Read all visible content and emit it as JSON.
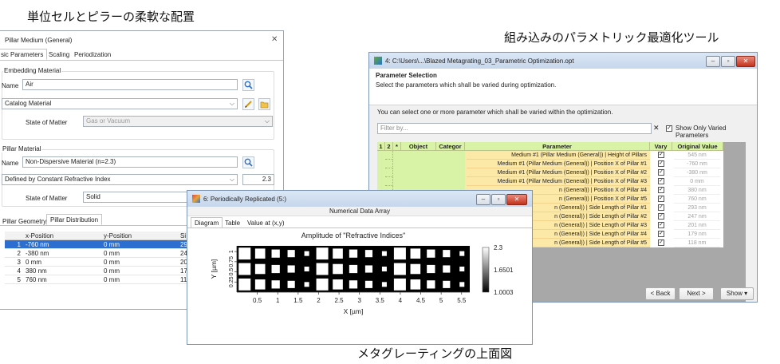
{
  "captions": {
    "top_left": "単位セルとピラーの柔軟な配置",
    "top_right": "組み込みのパラメトリック最適化ツール",
    "bottom": "メタグレーティングの上面図"
  },
  "pillar_dialog": {
    "title": "Pillar Medium (General)",
    "close": "✕",
    "tabs": [
      "sic Parameters",
      "Scaling",
      "Periodization"
    ],
    "embedding_group": "Embedding Material",
    "name_label": "Name",
    "name_value": "Air",
    "catalog_value": "Catalog Material",
    "state_label": "State of Matter",
    "state_value": "Gas or Vacuum",
    "pillar_group": "Pillar Material",
    "pillar_name_value": "Non-Dispersive Material (n=2.3)",
    "defined_by_value": "Defined by Constant Refractive Index",
    "refractive_index": "2.3",
    "pillar_state_value": "Solid",
    "lower_tabs": [
      "Pillar Geometry",
      "Pillar Distribution"
    ],
    "grid_headers": [
      "x-Position",
      "y-Position",
      "Si"
    ],
    "rows": [
      {
        "n": "1",
        "x": "-760 nm",
        "y": "0 mm",
        "s": "29"
      },
      {
        "n": "2",
        "x": "-380 nm",
        "y": "0 mm",
        "s": "24"
      },
      {
        "n": "3",
        "x": "0 mm",
        "y": "0 mm",
        "s": "20"
      },
      {
        "n": "4",
        "x": "380 nm",
        "y": "0 mm",
        "s": "17"
      },
      {
        "n": "5",
        "x": "760 nm",
        "y": "0 mm",
        "s": "11"
      }
    ]
  },
  "opt_window": {
    "title": "4: C:\\Users\\...\\Blazed Metagrating_03_Parametric Optimization.opt",
    "header_title": "Parameter Selection",
    "header_desc": "Select the parameters which shall be varied during optimization.",
    "instruction": "You can select one or more parameter which shall be varied within the optimization.",
    "filter_placeholder": "Filter by...",
    "filter_clear": "✕",
    "show_only_varied": "Show Only Varied Parameters",
    "headers": {
      "one": "1",
      "two": "2",
      "star": "*",
      "object": "Object",
      "category": "Categor",
      "parameter": "Parameter",
      "vary": "Vary",
      "original": "Original Value"
    },
    "params": [
      {
        "p": "Medium #1 (Pillar Medium (General)) | Height of Pillars",
        "v": "545 nm"
      },
      {
        "p": "Medium #1 (Pillar Medium (General)) | Position X of Pillar #1",
        "v": "-760 nm"
      },
      {
        "p": "Medium #1 (Pillar Medium (General)) | Position X of Pillar #2",
        "v": "-380 nm"
      },
      {
        "p": "Medium #1 (Pillar Medium (General)) | Position X of Pillar #3",
        "v": "0 mm"
      },
      {
        "p": "n (General)) | Position X of Pillar #4",
        "v": "380 nm"
      },
      {
        "p": "n (General)) | Position X of Pillar #5",
        "v": "760 nm"
      },
      {
        "p": "n (General)) | Side Length of Pillar #1",
        "v": "293 nm"
      },
      {
        "p": "n (General)) | Side Length of Pillar #2",
        "v": "247 nm"
      },
      {
        "p": "n (General)) | Side Length of Pillar #3",
        "v": "201 nm"
      },
      {
        "p": "n (General)) | Side Length of Pillar #4",
        "v": "179 nm"
      },
      {
        "p": "n (General)) | Side Length of Pillar #5",
        "v": "118 nm"
      }
    ],
    "back": "< Back",
    "next": "Next >",
    "show": "Show ▾"
  },
  "rep_window": {
    "title": "6: Periodically Replicated (5:)",
    "subtitle": "Numerical Data Array",
    "tabs": [
      "Diagram",
      "Table",
      "Value at (x,y)"
    ]
  },
  "chart_data": {
    "type": "heatmap",
    "title": "Amplitude of \"Refractive Indices\"",
    "xlabel": "X [µm]",
    "ylabel": "Y [µm]",
    "xlim": [
      0,
      5.7
    ],
    "ylim": [
      0,
      1.14
    ],
    "xticks": [
      "0.5",
      "1",
      "1.5",
      "2",
      "2.5",
      "3",
      "3.5",
      "4",
      "4.5",
      "5",
      "5.5"
    ],
    "xtick_values": [
      0.5,
      1,
      1.5,
      2,
      2.5,
      3,
      3.5,
      4,
      4.5,
      5,
      5.5
    ],
    "yticks": [
      "0.25",
      "0.5",
      "0.75",
      "1"
    ],
    "ytick_values": [
      0.25,
      0.5,
      0.75,
      1
    ],
    "colorbar_labels": [
      "2.3",
      "1.6501",
      "1.0003"
    ],
    "colorbar_range": [
      1.0003,
      2.3
    ],
    "background_value": 1.0003,
    "pillar_value": 2.3,
    "period_um": 1.9,
    "rows_y_um": [
      0.19,
      0.57,
      0.95
    ],
    "unit_cell_pillars": [
      {
        "x_um": 0.19,
        "side_um": 0.293
      },
      {
        "x_um": 0.57,
        "side_um": 0.247
      },
      {
        "x_um": 0.95,
        "side_um": 0.201
      },
      {
        "x_um": 1.33,
        "side_um": 0.179
      },
      {
        "x_um": 1.71,
        "side_um": 0.118
      }
    ],
    "periods": 3
  }
}
